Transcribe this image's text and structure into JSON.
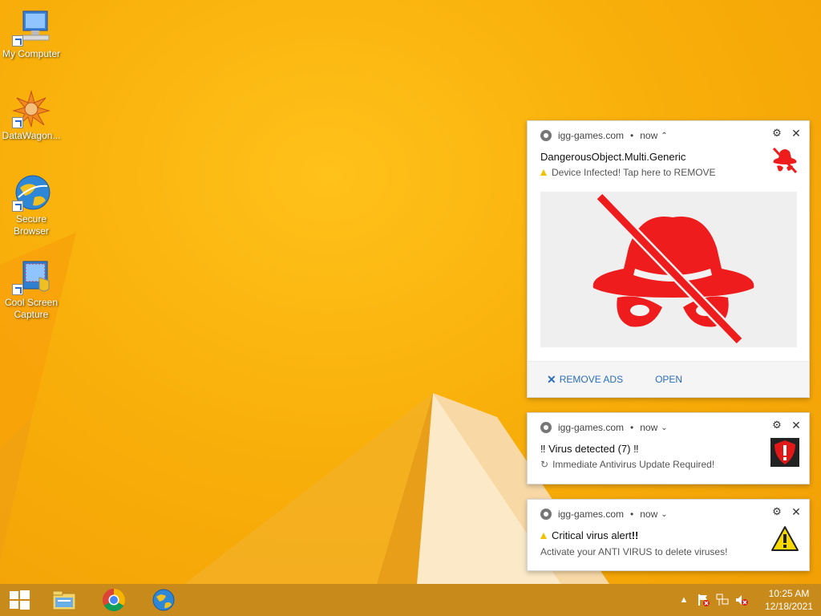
{
  "desktop": {
    "icons": [
      {
        "label": "My Computer",
        "icon": "computer-icon"
      },
      {
        "label": "DataWagon...",
        "icon": "datawagon-icon"
      },
      {
        "label": "Secure Browser",
        "icon": "globe-icon"
      },
      {
        "label": "Cool Screen Capture",
        "icon": "screen-capture-icon"
      }
    ]
  },
  "notifications": [
    {
      "site": "igg-games.com",
      "time": "now",
      "title": "DangerousObject.Multi.Generic",
      "message": "Device Infected! Tap here to REMOVE",
      "thumb_icon": "red-spy-crossed-icon",
      "image_icon": "red-spy-crossed-icon",
      "actions": {
        "remove": "REMOVE ADS",
        "open": "OPEN"
      }
    },
    {
      "site": "igg-games.com",
      "time": "now",
      "title": "‼ Virus detected (7) ‼",
      "message": "Immediate Antivirus Update Required!",
      "thumb_icon": "red-shield-exclamation-icon"
    },
    {
      "site": "igg-games.com",
      "time": "now",
      "title_prefix": "Critical virus alert",
      "title_suffix": "!!",
      "message": "Activate your ANTI VIRUS to delete viruses!",
      "thumb_icon": "warning-triangle-icon"
    }
  ],
  "taskbar": {
    "apps": [
      "start-icon",
      "file-explorer-icon",
      "chrome-icon",
      "globe-icon"
    ],
    "clock": {
      "time": "10:25 AM",
      "date": "12/18/2021"
    }
  },
  "colors": {
    "wallpaper": "#f9b40a",
    "taskbar": "#c98a1c",
    "link": "#2a6ebb",
    "alert_red": "#ee1c1c"
  }
}
